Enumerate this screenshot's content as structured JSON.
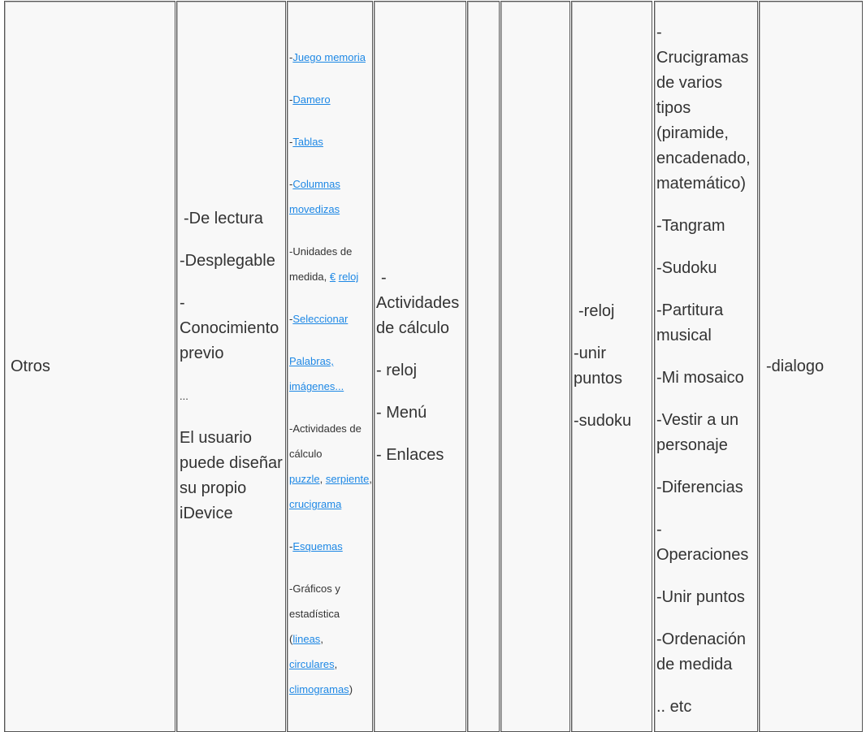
{
  "table": {
    "col1": {
      "text": "Otros"
    },
    "col2": {
      "items": [
        "-De lectura",
        "-Desplegable",
        "-Conocimiento previo",
        "...",
        "El usuario puede diseñar su propio iDevice"
      ]
    },
    "col3": {
      "prefix": "-",
      "juego_memoria": "Juego memoria",
      "damero": "Damero",
      "tablas": "Tablas",
      "columnas_movedizas": "Columnas movedizas",
      "unidades_medida": "-Unidades de medida,",
      "euro": "€",
      "reloj": "reloj",
      "seleccionar": "Seleccionar",
      "palabras_imagenes": "Palabras, imágenes...",
      "actividades_calculo": "-Actividades de cálculo",
      "puzzle": "puzzle",
      "serpiente": "serpiente",
      "crucigrama": "crucigrama",
      "comma": ",",
      "esquemas": "Esquemas",
      "graficos_estadistica": "-Gráficos y estadística",
      "open_paren": "(",
      "lineas": "lineas",
      "circulares": "circulares",
      "climogramas": "climogramas",
      "close_paren": ")"
    },
    "col4": {
      "items": [
        "- Actividades de cálculo",
        "- reloj",
        "- Menú",
        "- Enlaces"
      ]
    },
    "col7": {
      "items": [
        "-reloj",
        "-unir puntos",
        "-sudoku"
      ]
    },
    "col8": {
      "items": [
        "- Crucigramas de varios tipos (piramide, encadenado, matemático)",
        "-Tangram",
        "-Sudoku",
        "-Partitura musical",
        "-Mi mosaico",
        "-Vestir a un personaje",
        "-Diferencias",
        "- Operaciones",
        "-Unir puntos",
        "-Ordenación de medida",
        ".. etc"
      ]
    },
    "col9": {
      "text": "-dialogo"
    }
  }
}
